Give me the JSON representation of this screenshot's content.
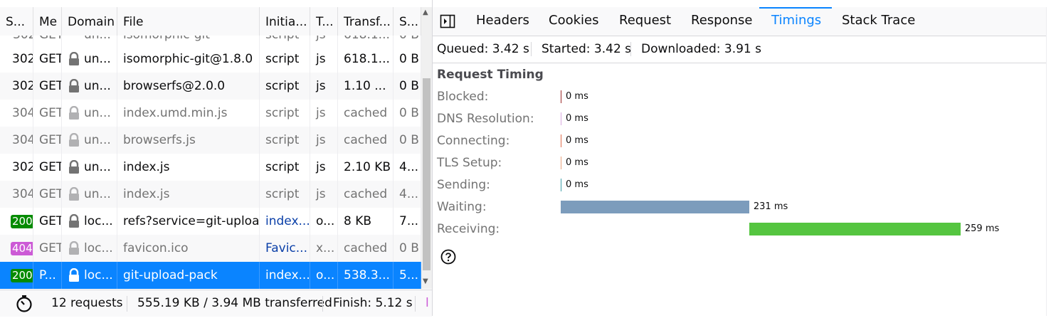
{
  "columns": [
    "S...",
    "Me",
    "Domain",
    "File",
    "Initia...",
    "T...",
    "Transf...",
    "S..."
  ],
  "clipped_row": {
    "status": "302",
    "method": "GET",
    "domain": "un...",
    "file": "isomorphic-git",
    "initiator": "script",
    "type": "js",
    "transferred": "618.1...",
    "size": "0 B"
  },
  "rows": [
    {
      "status": "302",
      "badge": "",
      "method": "GET",
      "domain": "un...",
      "file": "isomorphic-git@1.8.0",
      "initiator": "script",
      "type": "js",
      "transferred": "618.1...",
      "size": "0 B",
      "cached": false
    },
    {
      "status": "302",
      "badge": "",
      "method": "GET",
      "domain": "un...",
      "file": "browserfs@2.0.0",
      "initiator": "script",
      "type": "js",
      "transferred": "1.10 ...",
      "size": "0 B",
      "cached": false
    },
    {
      "status": "304",
      "badge": "",
      "method": "GET",
      "domain": "un...",
      "file": "index.umd.min.js",
      "initiator": "script",
      "type": "js",
      "transferred": "cached",
      "size": "0 B",
      "cached": true
    },
    {
      "status": "304",
      "badge": "",
      "method": "GET",
      "domain": "un...",
      "file": "browserfs.js",
      "initiator": "script",
      "type": "js",
      "transferred": "cached",
      "size": "0 B",
      "cached": true
    },
    {
      "status": "302",
      "badge": "",
      "method": "GET",
      "domain": "un...",
      "file": "index.js",
      "initiator": "script",
      "type": "js",
      "transferred": "2.10 KB",
      "size": "4...",
      "cached": false
    },
    {
      "status": "304",
      "badge": "",
      "method": "GET",
      "domain": "un...",
      "file": "index.js",
      "initiator": "script",
      "type": "js",
      "transferred": "cached",
      "size": "4...",
      "cached": true
    },
    {
      "status": "200",
      "badge": "b200",
      "method": "GET",
      "domain": "loc...",
      "file": "refs?service=git-upload-pack",
      "initiator": "index...",
      "type": "o...",
      "transferred": "8 KB",
      "size": "7...",
      "cached": false
    },
    {
      "status": "404",
      "badge": "b404",
      "method": "GET",
      "domain": "loc...",
      "file": "favicon.ico",
      "initiator": "Favic...",
      "type": "x...",
      "transferred": "cached",
      "size": "0 B",
      "cached": true
    },
    {
      "status": "200",
      "badge": "b200",
      "method": "P...",
      "domain": "loc...",
      "file": "git-upload-pack",
      "initiator": "index...",
      "type": "o...",
      "transferred": "538.3...",
      "size": "5...",
      "cached": false,
      "selected": true
    }
  ],
  "footer": {
    "requests": "12 requests",
    "transferred": "555.19 KB / 3.94 MB transferred",
    "finish": "Finish: 5.12 s",
    "clipped": "l"
  },
  "tabs": [
    "Headers",
    "Cookies",
    "Request",
    "Response",
    "Timings",
    "Stack Trace"
  ],
  "active_tab": "Timings",
  "summary": {
    "queued": "Queued: 3.42 s",
    "started": "Started: 3.42 s",
    "downloaded": "Downloaded: 3.91 s"
  },
  "timing": {
    "title": "Request Timing",
    "phases": [
      {
        "label": "Blocked:",
        "value": "0 ms",
        "color": "#9c2a2a"
      },
      {
        "label": "DNS Resolution:",
        "value": "0 ms",
        "color": "#d9a9e0"
      },
      {
        "label": "Connecting:",
        "value": "0 ms",
        "color": "#e06c4c"
      },
      {
        "label": "TLS Setup:",
        "value": "0 ms",
        "color": "#e8a27c"
      },
      {
        "label": "Sending:",
        "value": "0 ms",
        "color": "#3f9fa8"
      },
      {
        "label": "Waiting:",
        "value": "231 ms",
        "color": "#7c9cbc"
      },
      {
        "label": "Receiving:",
        "value": "259 ms",
        "color": "#55c540"
      }
    ]
  },
  "colors": {
    "accent": "#0a84ff",
    "status_200": "#058b00",
    "status_404": "#cc5ad6"
  }
}
